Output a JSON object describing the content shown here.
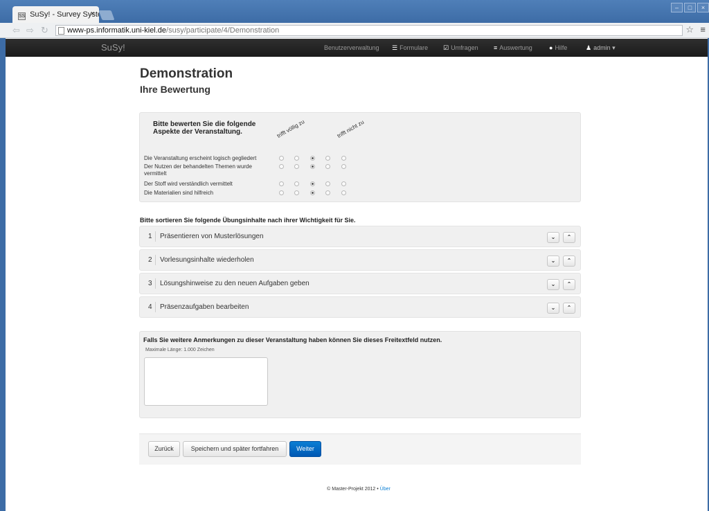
{
  "browser": {
    "tab_title": "SuSy! - Survey System",
    "tab_favicon": "SS",
    "tab_close": "×",
    "url_host": "www-ps.informatik.uni-kiel.de",
    "url_path": "/susy/participate/4/Demonstration",
    "window_buttons": [
      "–",
      "□",
      "×"
    ]
  },
  "navbar": {
    "brand": "SuSy!",
    "items": [
      {
        "label": "Benutzerverwaltung",
        "icon": ""
      },
      {
        "label": "Formulare",
        "icon": "list-icon"
      },
      {
        "label": "Umfragen",
        "icon": "check-icon"
      },
      {
        "label": "Auswertung",
        "icon": "align-icon"
      },
      {
        "label": "Hilfe",
        "icon": "question-icon"
      },
      {
        "label": "admin",
        "icon": "user-icon"
      }
    ]
  },
  "page": {
    "title": "Demonstration",
    "subtitle": "Ihre Bewertung"
  },
  "rating": {
    "title": "Bitte bewerten Sie die folgende Aspekte der Veranstaltung.",
    "scale_low": "trifft völlig zu",
    "scale_high": "trifft nicht zu",
    "rows": [
      {
        "label": "Die Veranstaltung erscheint logisch gegliedert",
        "selected": 3
      },
      {
        "label": "Der Nutzen der behandelten Themen wurde vermittelt",
        "selected": 3
      },
      {
        "label": "Der Stoff wird verständlich vermittelt",
        "selected": 3
      },
      {
        "label": "Die Materialien sind hilfreich",
        "selected": 3
      }
    ]
  },
  "sorting": {
    "title": "Bitte sortieren Sie folgende Übungsinhalte nach ihrer Wichtigkeit für Sie.",
    "items": [
      {
        "num": "1",
        "label": "Präsentieren von Musterlösungen"
      },
      {
        "num": "2",
        "label": "Vorlesungsinhalte wiederholen"
      },
      {
        "num": "3",
        "label": "Lösungshinweise zu den neuen Aufgaben geben"
      },
      {
        "num": "4",
        "label": "Präsenzaufgaben bearbeiten"
      }
    ],
    "down_glyph": "⌄",
    "up_glyph": "⌃"
  },
  "freetext": {
    "title": "Falls Sie weitere Anmerkungen zu dieser Veranstaltung haben können Sie dieses Freitextfeld nutzen.",
    "hint": "Maximale Länge: 1.000 Zeichen",
    "value": ""
  },
  "buttons": {
    "back": "Zurück",
    "save": "Speichern und später fortfahren",
    "next": "Weiter"
  },
  "footer": {
    "copyright": "© Master-Projekt 2012 • ",
    "link": "Über"
  },
  "colors": {
    "primary": "#0a7ed4",
    "navbar": "#1b1b1b",
    "window_frame": "#3d6ca6"
  }
}
